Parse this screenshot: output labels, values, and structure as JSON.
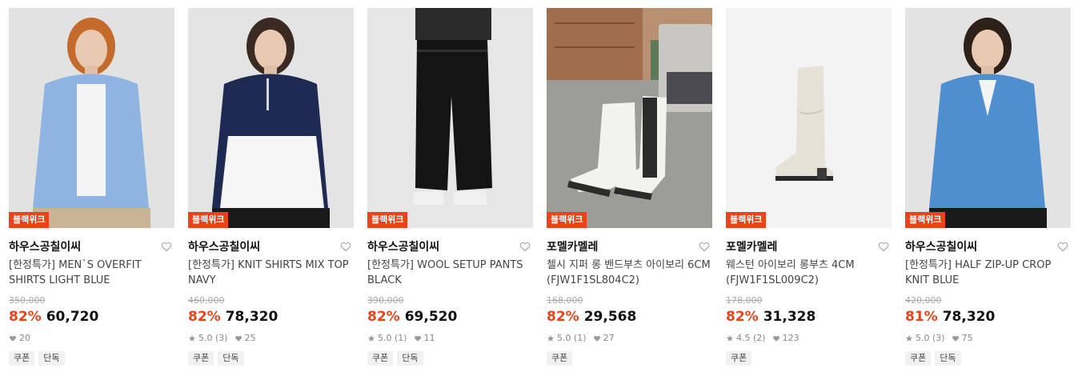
{
  "products": [
    {
      "badge": "블랙위크",
      "brand": "하우스공칠이씨",
      "name": "[한정특가] MEN`S OVERFIT SHIRTS LIGHT BLUE",
      "original_price": "350,000",
      "discount": "82%",
      "price": "60,720",
      "rating": "",
      "likes": "20",
      "tags": [
        "쿠폰",
        "단독"
      ],
      "image_colors": {
        "bg": "#e2e2e2",
        "main": "#8fb4e2",
        "accent": "#f4f4f4",
        "bottom": "#c8b596",
        "hair": "#c46b2c"
      }
    },
    {
      "badge": "블랙위크",
      "brand": "하우스공칠이씨",
      "name": "[한정특가] KNIT SHIRTS MIX TOP NAVY",
      "original_price": "460,000",
      "discount": "82%",
      "price": "78,320",
      "rating": "5.0 (3)",
      "likes": "25",
      "tags": [
        "쿠폰",
        "단독"
      ],
      "image_colors": {
        "bg": "#e4e4e4",
        "main": "#1e2a52",
        "accent": "#f6f6f6",
        "bottom": "#1a1a1a",
        "hair": "#3a2a22"
      }
    },
    {
      "badge": "블랙위크",
      "brand": "하우스공칠이씨",
      "name": "[한정특가] WOOL SETUP PANTS BLACK",
      "original_price": "390,000",
      "discount": "82%",
      "price": "69,520",
      "rating": "5.0 (1)",
      "likes": "11",
      "tags": [
        "쿠폰",
        "단독"
      ],
      "image_colors": {
        "bg": "#e6e6e6",
        "main": "#141414",
        "accent": "#f0f0f0",
        "bottom": "#141414",
        "hair": "#141414"
      }
    },
    {
      "badge": "블랙위크",
      "brand": "포멜카멜레",
      "name": "첼시 지퍼 롱 밴드부츠 아이보리 6CM (FJW1F1SL804C2)",
      "original_price": "168,000",
      "discount": "82%",
      "price": "29,568",
      "rating": "5.0 (1)",
      "likes": "27",
      "tags": [
        "쿠폰"
      ],
      "image_colors": {
        "bg": "#b89072",
        "main": "#f2f2ee",
        "accent": "#2b2b2b",
        "bottom": "#8a5a3a",
        "hair": "#6f4a30"
      }
    },
    {
      "badge": "블랙위크",
      "brand": "포멜카멜레",
      "name": "웨스턴 아이보리 롱부츠 4CM (FJW1F1SL009C2)",
      "original_price": "178,000",
      "discount": "82%",
      "price": "31,328",
      "rating": "4.5 (2)",
      "likes": "123",
      "tags": [
        "쿠폰"
      ],
      "image_colors": {
        "bg": "#f3f3f3",
        "main": "#e6e1d6",
        "accent": "#2a2a2a",
        "bottom": "#f3f3f3",
        "hair": "#f3f3f3"
      }
    },
    {
      "badge": "블랙위크",
      "brand": "하우스공칠이씨",
      "name": "[한정특가] HALF ZIP-UP CROP KNIT BLUE",
      "original_price": "420,000",
      "discount": "81%",
      "price": "78,320",
      "rating": "5.0 (3)",
      "likes": "75",
      "tags": [
        "쿠폰",
        "단독"
      ],
      "image_colors": {
        "bg": "#e3e3e3",
        "main": "#4f8fcf",
        "accent": "#f4f4f4",
        "bottom": "#1a1a1a",
        "hair": "#2d2018"
      }
    }
  ]
}
